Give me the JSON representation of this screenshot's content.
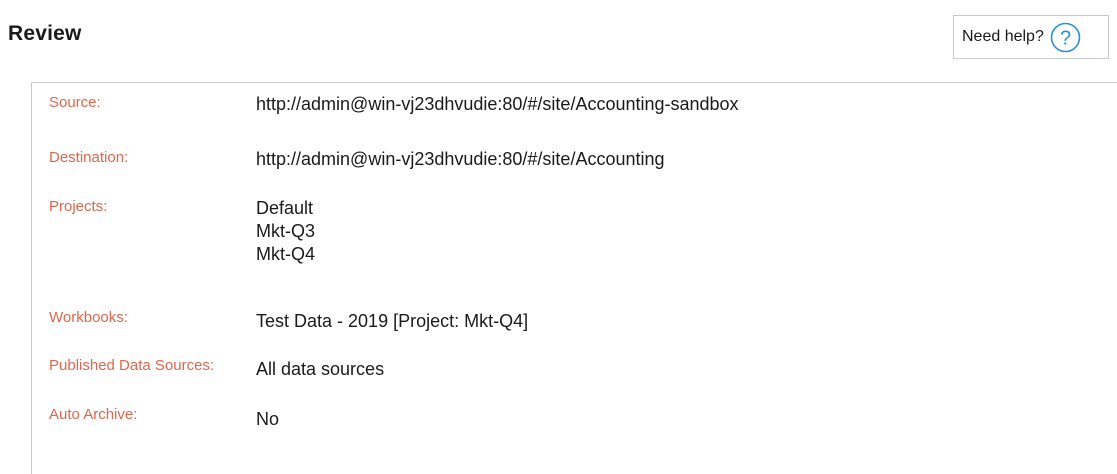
{
  "header": {
    "title": "Review",
    "help_label": "Need help?",
    "help_icon": "question-circle-icon",
    "help_icon_color": "#2d8fd6"
  },
  "colors": {
    "label": "#e0664a",
    "value": "#1a1a1a",
    "border": "#c8c8c8"
  },
  "review": {
    "source_label": "Source:",
    "source_value": "http://admin@win-vj23dhvudie:80/#/site/Accounting-sandbox",
    "destination_label": "Destination:",
    "destination_value": "http://admin@win-vj23dhvudie:80/#/site/Accounting",
    "projects_label": "Projects:",
    "projects": [
      "Default",
      "Mkt-Q3",
      "Mkt-Q4"
    ],
    "workbooks_label": "Workbooks:",
    "workbooks_value": "Test Data - 2019 [Project: Mkt-Q4]",
    "published_data_sources_label": "Published Data Sources:",
    "published_data_sources_value": "All data sources",
    "auto_archive_label": "Auto Archive:",
    "auto_archive_value": "No"
  }
}
